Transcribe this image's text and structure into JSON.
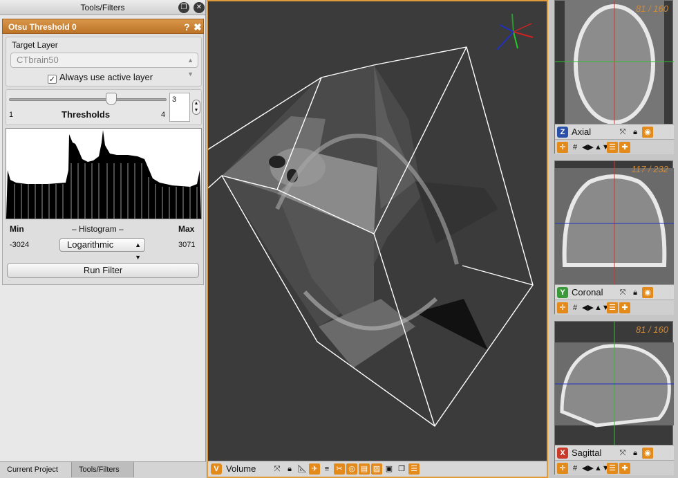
{
  "tools_panel": {
    "title": "Tools/Filters",
    "restore_icon": "restore-window-icon",
    "close_icon": "close-icon"
  },
  "filter": {
    "title": "Otsu Threshold 0",
    "help_label": "?",
    "close_label": "✖",
    "target_layer_label": "Target Layer",
    "target_layer_value": "CTbrain50",
    "always_active_label": "Always use active layer",
    "always_active_checked": true,
    "thresholds_label": "Thresholds",
    "slider_min": "1",
    "slider_max": "4",
    "thresholds_value": "3",
    "histogram_title": "– Histogram –",
    "min_label": "Min",
    "max_label": "Max",
    "min_value": "-3024",
    "max_value": "3071",
    "histogram_mode": "Logarithmic",
    "run_button": "Run Filter"
  },
  "bottom_tabs": [
    {
      "label": "Current Project",
      "active": false
    },
    {
      "label": "Tools/Filters",
      "active": true
    }
  ],
  "view3d": {
    "badge": "V",
    "title": "Volume"
  },
  "side_views": [
    {
      "badge": "Z",
      "title": "Axial",
      "counter": "81 / 160",
      "badge_color": "#2a4fa8"
    },
    {
      "badge": "Y",
      "title": "Coronal",
      "counter": "117 / 232",
      "badge_color": "#3a9a3a"
    },
    {
      "badge": "X",
      "title": "Sagittal",
      "counter": "81 / 160",
      "badge_color": "#c83a2a"
    }
  ],
  "colors": {
    "accent": "#e09a3c",
    "filter_header": "#c47e30"
  }
}
